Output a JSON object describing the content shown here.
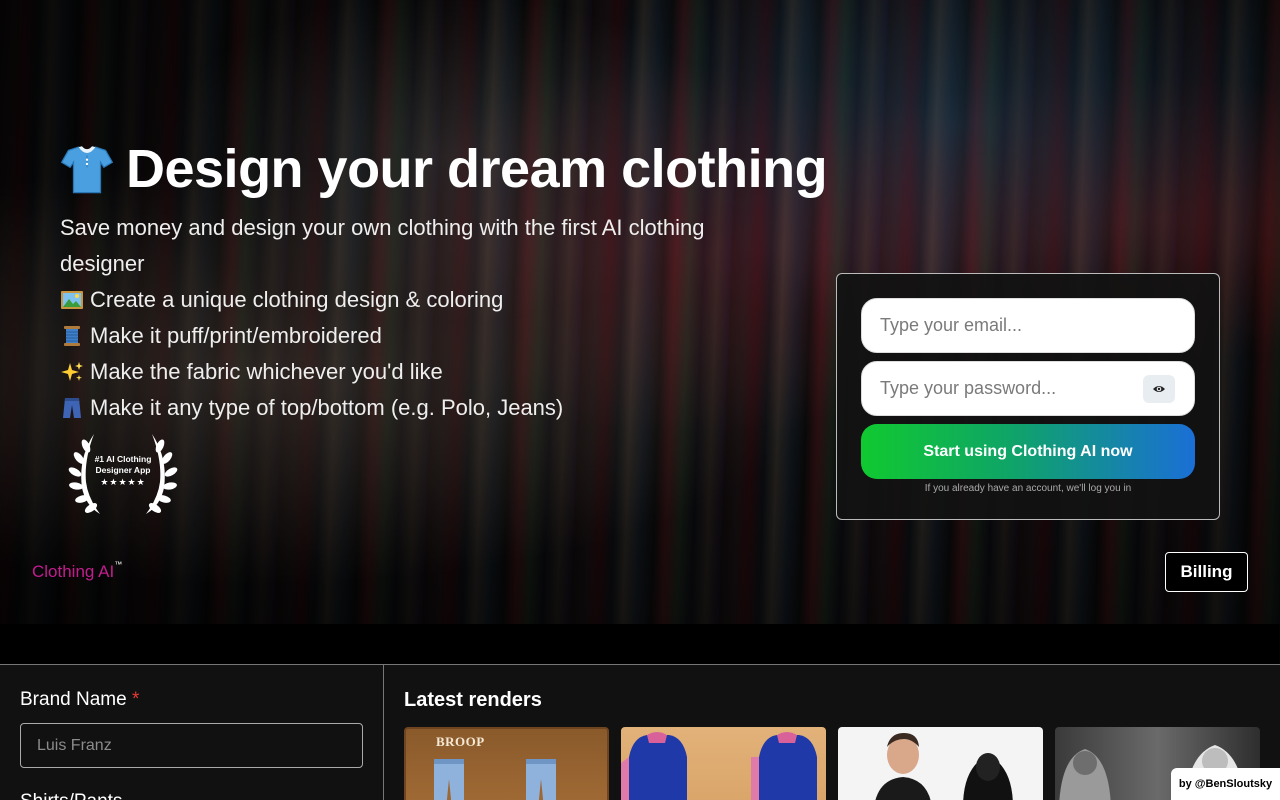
{
  "hero": {
    "title": "Design your dream clothing",
    "subtitle": "Save money and design your own clothing with the first AI clothing designer",
    "features": [
      {
        "icon": "framed-picture-icon",
        "text": "Create a unique clothing design & coloring"
      },
      {
        "icon": "thread-spool-icon",
        "text": "Make it puff/print/embroidered"
      },
      {
        "icon": "sparkles-icon",
        "text": "Make the fabric whichever you'd like"
      },
      {
        "icon": "jeans-icon",
        "text": "Make it any type of top/bottom (e.g. Polo, Jeans)"
      }
    ],
    "award": {
      "line1": "#1 AI Clothing",
      "line2": "Designer App",
      "stars": "★★★★★"
    }
  },
  "signup": {
    "email_placeholder": "Type your email...",
    "password_placeholder": "Type your password...",
    "cta_label": "Start using Clothing AI now",
    "hint": "If you already have an account, we'll log you in"
  },
  "footer_nav": {
    "brand": "Clothing AI",
    "brand_mark": "™",
    "billing_label": "Billing"
  },
  "form": {
    "brand_name_label": "Brand Name",
    "required_mark": "*",
    "brand_name_placeholder": "Luis Franz",
    "next_label": "Shirts/Pants"
  },
  "renders": {
    "title": "Latest renders",
    "items": [
      {
        "label": "BROOP"
      },
      {
        "label": ""
      },
      {
        "label": ""
      },
      {
        "label": ""
      }
    ]
  },
  "credit": "by @BenSloutsky",
  "colors": {
    "brand": "#c21d8e",
    "cta_start": "#10c930",
    "cta_end": "#1a6fd6",
    "required": "#e53935"
  }
}
